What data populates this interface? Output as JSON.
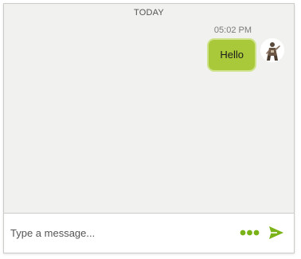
{
  "conversation": {
    "day_label": "TODAY",
    "messages": [
      {
        "time": "05:02 PM",
        "text": "Hello",
        "sender": "self",
        "avatar_icon": "user-avatar-icon"
      }
    ]
  },
  "composer": {
    "placeholder": "Type a message...",
    "value": "",
    "more_icon": "ellipsis-icon",
    "send_icon": "send-icon"
  },
  "colors": {
    "accent": "#7ab317",
    "bubble": "#a9c93a",
    "bubble_border": "#cfe38c",
    "conversation_background": "#f1f2ef"
  }
}
